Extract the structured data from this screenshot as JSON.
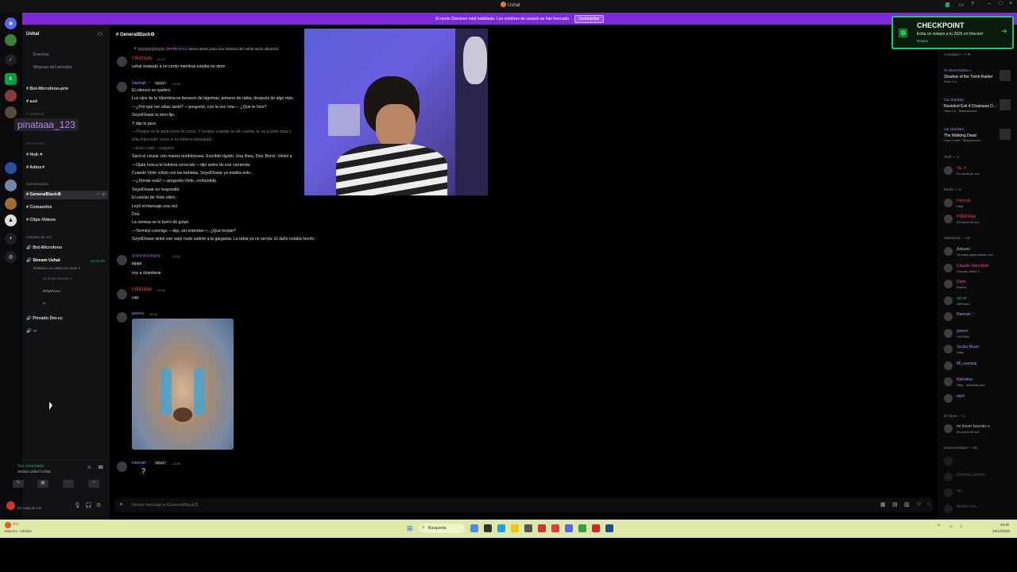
{
  "window": {
    "title": "Ushal"
  },
  "banner": {
    "text": "El modo Streamer está habilitado. Los nombres de usuario se han truncado.",
    "button": "Deshabilitar"
  },
  "server": {
    "name": "Ushal"
  },
  "channels": {
    "events": "Eventos",
    "boosts": "Mejoras del servidor",
    "items": [
      "Bot-Microfono-priv",
      "asd",
      "ushana"
    ],
    "tooltip_user": "pinataaa_123",
    "cat_bienvenida": "Bienvenida",
    "welcome_items": [
      "Holi-✦",
      "Adios✦"
    ],
    "cat_convo": "Conversacion",
    "convo_items": [
      "GeneralBlack⚙",
      "Comandos",
      "Clips-Videos"
    ],
    "cat_voice": "Canales de voz",
    "voice_items": [
      "Bot-Microfono",
      "Stream Ushal"
    ],
    "stream_time": "01:02:08",
    "stream_sub": "Establece un estado de canal ✐",
    "voice_users": [
      "mi dover favorito ∞",
      "PIÑATAAA",
      "u.."
    ],
    "private_voice": "Privado Dm-cc",
    "vs": "vs",
    "voice_connected": "Voz conectada",
    "voice_channel": "Stream Ushal / Ushal",
    "user_status": "En canal de voz"
  },
  "chat": {
    "channel": "GeneralBlack⚙",
    "reply_name": "@PIÑATAAA",
    "reply_text": "dame ideas para una historia del ushal ando aburrido",
    "m1_author": "PIÑATAAA",
    "m1_time": "22:27",
    "m1_text": "ushal violando a un cerdo mientras estaba en strim",
    "m2_author": "Hannah ♡",
    "m2_badge": "WOLF",
    "m2_time": "23:00",
    "story": [
      "El silencio se quebró.",
      "Los ojos de la Valentina se llenaron de lágrimas, primero de rabia, después de algo más.",
      "—¿Por qué me odias tanto? —preguntó, con la voz rota—. ¿Qué te hice?",
      "SoyelOswar la miró fijo.",
      "Y dijo lo peor.",
      "—Porque no te ama como tú crees. Y porque cuando se dé cuenta, te va a doler más c",
      "Ella retrocedió como si la hubiera empujado.",
      "—Eres cruel —susurró.",
      "Sacó el celular con manos temblorosas. Escribió rápido. Una línea. Dos. Borró. Volvió a",
      "—Ojalá nunca te hubiera conocido —dijo antes de irse corriendo.",
      "Cuando Viole volvió con las bebidas, SoyelOswar ya estaba solo.",
      "—¿Dónde está? —preguntó Viole, confundido.",
      "SoyelOswar no respondió.",
      "El celular de Viole vibró.",
      "Leyó el mensaje una vez.",
      "Dos.",
      "La sonrisa se le borró de golpe.",
      "—Terminó conmigo —dijo, sin entender—. ¿Qué hiciste?",
      "SoyelOswar sintió ese viejo nudo subirle a la garganta. La rabia ya no servía. El daño estaba hecho."
    ],
    "m3_author": "◎◎◎◎◎◎◎◎",
    "m3_time": "23:03",
    "m3_lines": [
      "jajaja",
      "voy a chambear"
    ],
    "m4_author": "PIÑATAAA",
    "m4_time": "23:05",
    "m4_text": "yap",
    "m5_author": "jaxervi",
    "m5_time": "23:04",
    "m6_author": "Hannah ♡",
    "m6_badge": "WOLF",
    "m6_time": "23:05",
    "m6_text": "?",
    "input_placeholder": "Enviar mensaje a #GeneralBlack⚙"
  },
  "promo": {
    "title": "CHECKPOINT",
    "text": "Echa un vistazo a tu 2025 en Discord",
    "sub": "Notaus"
  },
  "members": {
    "activity_header": "Actividad — 7 ⚙",
    "activity": [
      {
        "who": "mi dover favorito ∞",
        "game": "Shadow of the Tomb Raider",
        "sub": "Hace 1 d"
      },
      {
        "who": "Car chacharo",
        "game": "Resident Evil 4 Chainsaw D...",
        "sub": "Hace 3 d · Resurrección"
      },
      {
        "who": "Car chacharo",
        "game": "The Walking Dead",
        "sub": "Hace 3 sem · Resurrección"
      }
    ],
    "staff_header": "Staff — 1",
    "staff": [
      {
        "name": "Va..⚜",
        "sub": "En canal de voz",
        "color": "#f23f43"
      }
    ],
    "pitufa_header": "Pitufa — 2",
    "pitufa": [
      {
        "name": "Hannah",
        "sub": "Help",
        "color": "#f23f43"
      },
      {
        "name": "PIÑATAAA",
        "sub": "En canal de voz",
        "color": "#f23f43"
      }
    ],
    "members_header": "Miembros — 10",
    "members": [
      {
        "name": "Aokumi",
        "sub": "Ya estoy aprendiendo ma...",
        "color": "#b5bac1"
      },
      {
        "name": "Claudio Velocidad",
        "sub": "Counter Strike 2",
        "color": "#eb459f"
      },
      {
        "name": "Dedo",
        "sub": "Roblox",
        "color": "#eb459f"
      },
      {
        "name": "ed.nh",
        "sub": "OBPoker",
        "color": "#3ba55d"
      },
      {
        "name": "Hannah ♡",
        "sub": "",
        "color": "#c084fc"
      },
      {
        "name": "jaxervi",
        "sub": "YouTube",
        "color": "#a78bfa"
      },
      {
        "name": "Jockie Music",
        "sub": "/help",
        "color": "#a78bfa"
      },
      {
        "name": "Mi_esencia",
        "sub": "",
        "color": "#c084fc"
      },
      {
        "name": "Nekotina",
        "sub": "Help · nekotina.com",
        "color": "#c084fc"
      },
      {
        "name": "stylo",
        "sub": "",
        "color": "#a78bfa"
      }
    ],
    "online_header": "En línea — 1",
    "online": [
      {
        "name": "mi dover favorito ∞",
        "sub": "En canal de voz",
        "color": "#b5bac1"
      }
    ],
    "offline_header": "Desconectado — 45",
    "offline": [
      "..",
      "Gabriela Santos",
      "ep...",
      "Ardent Fun..."
    ]
  },
  "taskbar": {
    "weather": "8°C",
    "weather_sub": "Mayorm. nublado",
    "search": "Búsqueda",
    "time": "23:35",
    "date": "29/12/2025"
  }
}
